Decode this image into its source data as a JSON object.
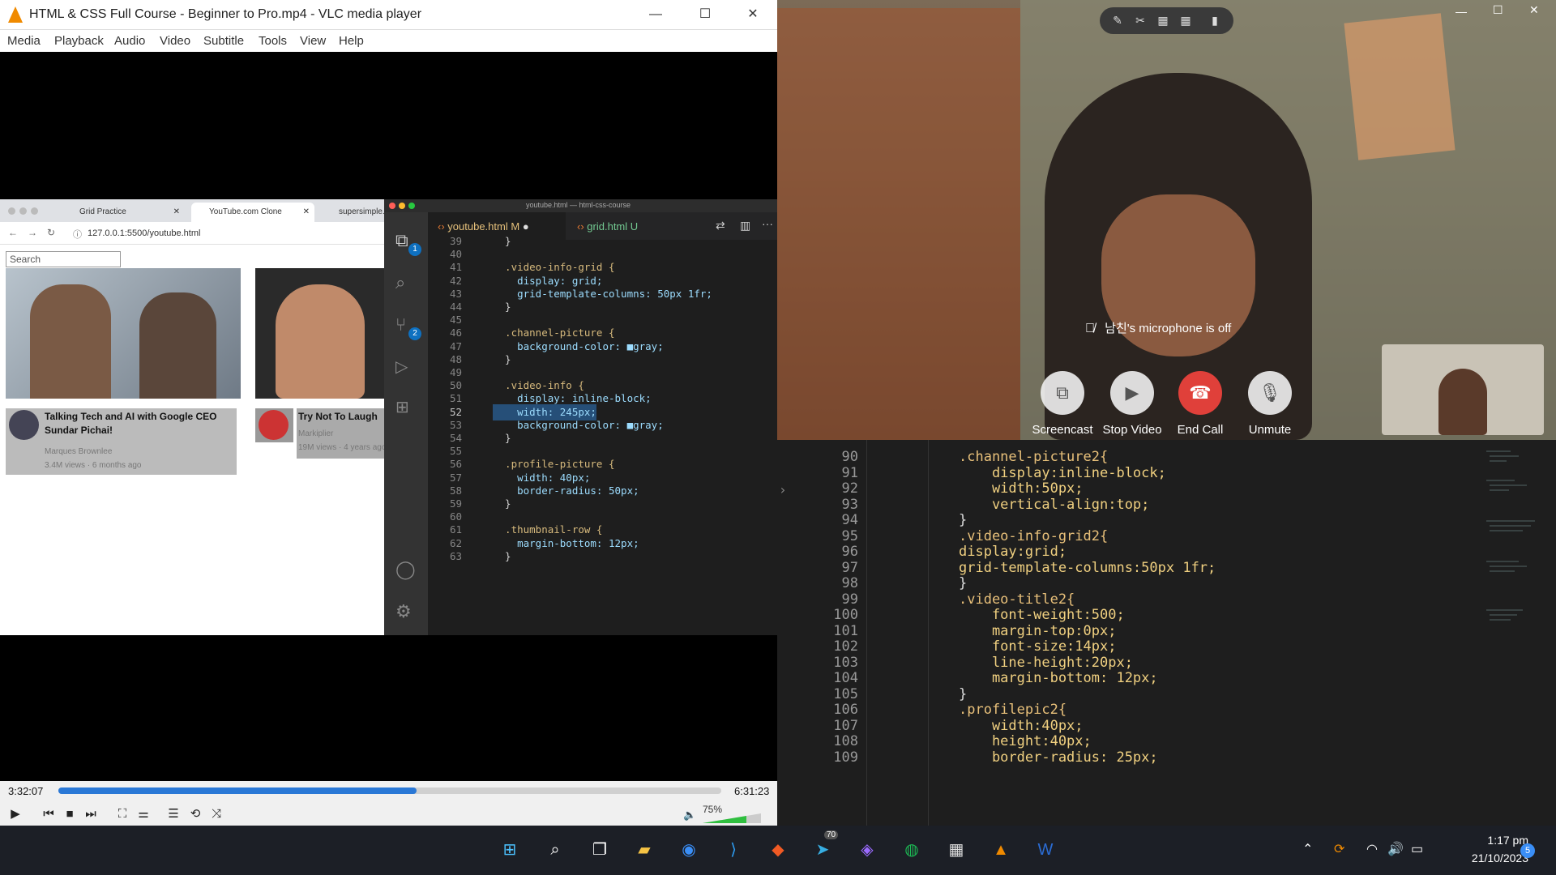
{
  "vlc": {
    "title": "HTML & CSS Full Course - Beginner to Pro.mp4 - VLC media player",
    "menu": [
      "Media",
      "Playback",
      "Audio",
      "Video",
      "Subtitle",
      "Tools",
      "View",
      "Help"
    ],
    "time_current": "3:32:07",
    "time_total": "6:31:23",
    "progress_fraction": 0.54,
    "volume": "75%"
  },
  "browser": {
    "tabs": [
      "Grid Practice",
      "YouTube.com Clone",
      "supersimple..."
    ],
    "url": "127.0.0.1:5500/youtube.html",
    "search_placeholder": "Search",
    "videos": [
      {
        "title": "Talking Tech and AI with Google CEO Sundar Pichai!",
        "author": "Marques Brownlee",
        "stats": "3.4M views · 6 months ago"
      },
      {
        "title": "Try Not To Laugh",
        "author": "Markiplier",
        "stats": "19M views · 4 years ago"
      }
    ]
  },
  "vscode": {
    "title": "youtube.html — html-css-course",
    "tabs": [
      {
        "name": "youtube.html",
        "status": "M"
      },
      {
        "name": "grid.html",
        "status": "U"
      }
    ],
    "badges": {
      "explorer": "1",
      "scm": "2"
    },
    "lines": [
      {
        "n": "39",
        "t": "  }"
      },
      {
        "n": "40",
        "t": ""
      },
      {
        "n": "41",
        "t": "  .video-info-grid {"
      },
      {
        "n": "42",
        "t": "    display: grid;"
      },
      {
        "n": "43",
        "t": "    grid-template-columns: 50px 1fr;"
      },
      {
        "n": "44",
        "t": "  }"
      },
      {
        "n": "45",
        "t": ""
      },
      {
        "n": "46",
        "t": "  .channel-picture {"
      },
      {
        "n": "47",
        "t": "    background-color: ■gray;"
      },
      {
        "n": "48",
        "t": "  }"
      },
      {
        "n": "49",
        "t": ""
      },
      {
        "n": "50",
        "t": "  .video-info {"
      },
      {
        "n": "51",
        "t": "    display: inline-block;"
      },
      {
        "n": "52",
        "t": "    width: 245px;"
      },
      {
        "n": "53",
        "t": "    background-color: ■gray;"
      },
      {
        "n": "54",
        "t": "  }"
      },
      {
        "n": "55",
        "t": ""
      },
      {
        "n": "56",
        "t": "  .profile-picture {"
      },
      {
        "n": "57",
        "t": "    width: 40px;"
      },
      {
        "n": "58",
        "t": "    border-radius: 50px;"
      },
      {
        "n": "59",
        "t": "  }"
      },
      {
        "n": "60",
        "t": ""
      },
      {
        "n": "61",
        "t": "  .thumbnail-row {"
      },
      {
        "n": "62",
        "t": "    margin-bottom: 12px;"
      },
      {
        "n": "63",
        "t": "  }"
      }
    ]
  },
  "call": {
    "mic_off_notice": "남친's microphone is off",
    "buttons": {
      "screencast": "Screencast",
      "stop_video": "Stop Video",
      "end_call": "End Call",
      "unmute": "Unmute"
    }
  },
  "editor2": {
    "lines": [
      {
        "n": "90",
        "t": ".channel-picture2{"
      },
      {
        "n": "91",
        "t": "    display:inline-block;"
      },
      {
        "n": "92",
        "t": "    width:50px;"
      },
      {
        "n": "93",
        "t": "    vertical-align:top;"
      },
      {
        "n": "94",
        "t": "}"
      },
      {
        "n": "95",
        "t": ".video-info-grid2{"
      },
      {
        "n": "96",
        "t": "display:grid;"
      },
      {
        "n": "97",
        "t": "grid-template-columns:50px 1fr;"
      },
      {
        "n": "98",
        "t": "}"
      },
      {
        "n": "99",
        "t": ".video-title2{"
      },
      {
        "n": "100",
        "t": "    font-weight:500;"
      },
      {
        "n": "101",
        "t": "    margin-top:0px;"
      },
      {
        "n": "102",
        "t": "    font-size:14px;"
      },
      {
        "n": "103",
        "t": "    line-height:20px;"
      },
      {
        "n": "104",
        "t": "    margin-bottom: 12px;"
      },
      {
        "n": "105",
        "t": "}"
      },
      {
        "n": "106",
        "t": ".profilepic2{"
      },
      {
        "n": "107",
        "t": "    width:40px;"
      },
      {
        "n": "108",
        "t": "    height:40px;"
      },
      {
        "n": "109",
        "t": "    border-radius: 25px;"
      }
    ]
  },
  "taskbar": {
    "time": "1:17 pm",
    "date": "21/10/2023",
    "notification_count": "5",
    "telegram_badge": "70"
  }
}
